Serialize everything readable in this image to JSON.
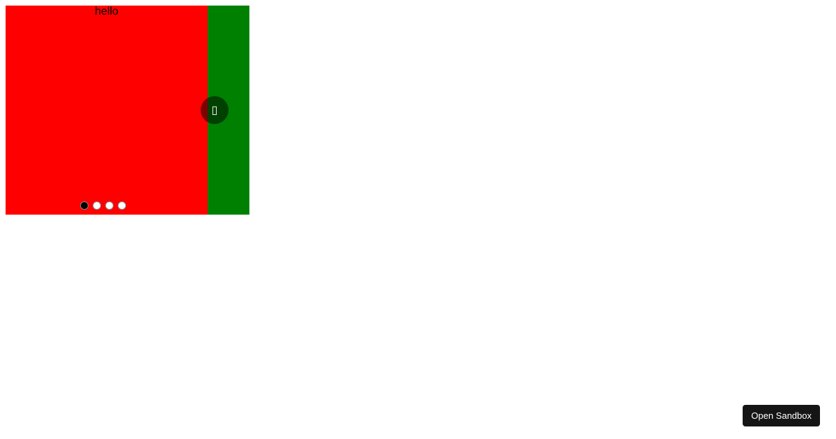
{
  "carousel": {
    "slides": [
      {
        "label": "hello",
        "color": "#ff0000"
      },
      {
        "label": "",
        "color": "#008000"
      }
    ],
    "next_glyph": "▯",
    "dot_count": 4,
    "active_dot": 0
  },
  "sandbox": {
    "button_label": "Open Sandbox"
  }
}
